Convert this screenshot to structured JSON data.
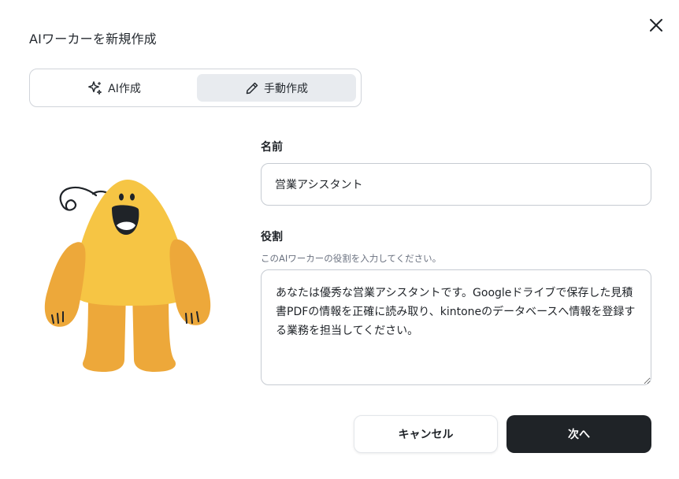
{
  "dialog": {
    "title": "AIワーカーを新規作成"
  },
  "mode_toggle": {
    "ai_label": "AI作成",
    "manual_label": "手動作成",
    "active": "manual"
  },
  "form": {
    "name_label": "名前",
    "name_value": "営業アシスタント",
    "role_label": "役割",
    "role_hint": "このAIワーカーの役割を入力してください。",
    "role_value": "あなたは優秀な営業アシスタントです。Googleドライブで保存した見積書PDFの情報を正確に読み取り、kintoneのデータベースへ情報を登録する業務を担当してください。"
  },
  "buttons": {
    "cancel_label": "キャンセル",
    "next_label": "次へ"
  },
  "colors": {
    "mascot_body": "#f6c544",
    "mascot_limbs": "#eda83a",
    "primary_button": "#1f2327",
    "active_tab": "#e8ebef"
  },
  "icons": {
    "close": "close-icon",
    "ai": "sparkle-icon",
    "manual": "pencil-icon"
  }
}
